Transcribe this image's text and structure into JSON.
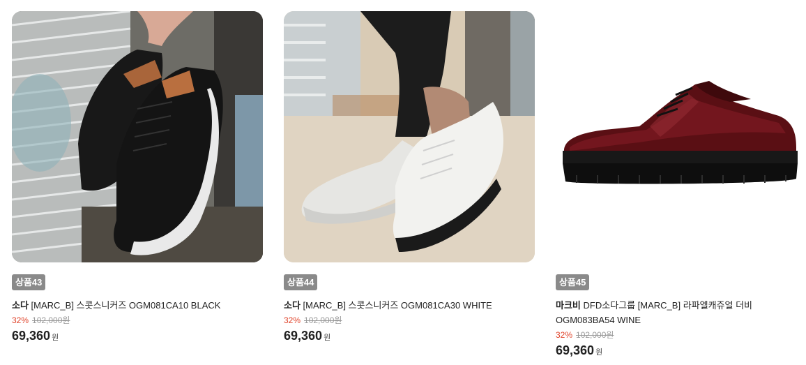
{
  "products": [
    {
      "badge": "상품43",
      "brand": "소다",
      "name": "[MARC_B] 스콧스니커즈 OGM081CA10 BLACK",
      "discount": "32%",
      "original_price": "102,000원",
      "price": "69,360",
      "currency": "원",
      "image": "black-sneakers-photo"
    },
    {
      "badge": "상품44",
      "brand": "소다",
      "name": "[MARC_B] 스콧스니커즈 OGM081CA30 WHITE",
      "discount": "32%",
      "original_price": "102,000원",
      "price": "69,360",
      "currency": "원",
      "image": "white-sneakers-photo"
    },
    {
      "badge": "상품45",
      "brand": "마크비",
      "name": "DFD소다그룹 [MARC_B] 라파엘캐쥬얼 더비 OGM083BA54 WINE",
      "discount": "32%",
      "original_price": "102,000원",
      "price": "69,360",
      "currency": "원",
      "image": "wine-derby-shoe-photo"
    }
  ],
  "colors": {
    "badge_bg": "#8a8a8a",
    "discount": "#e0442b",
    "original_price": "#9a9a9a"
  }
}
